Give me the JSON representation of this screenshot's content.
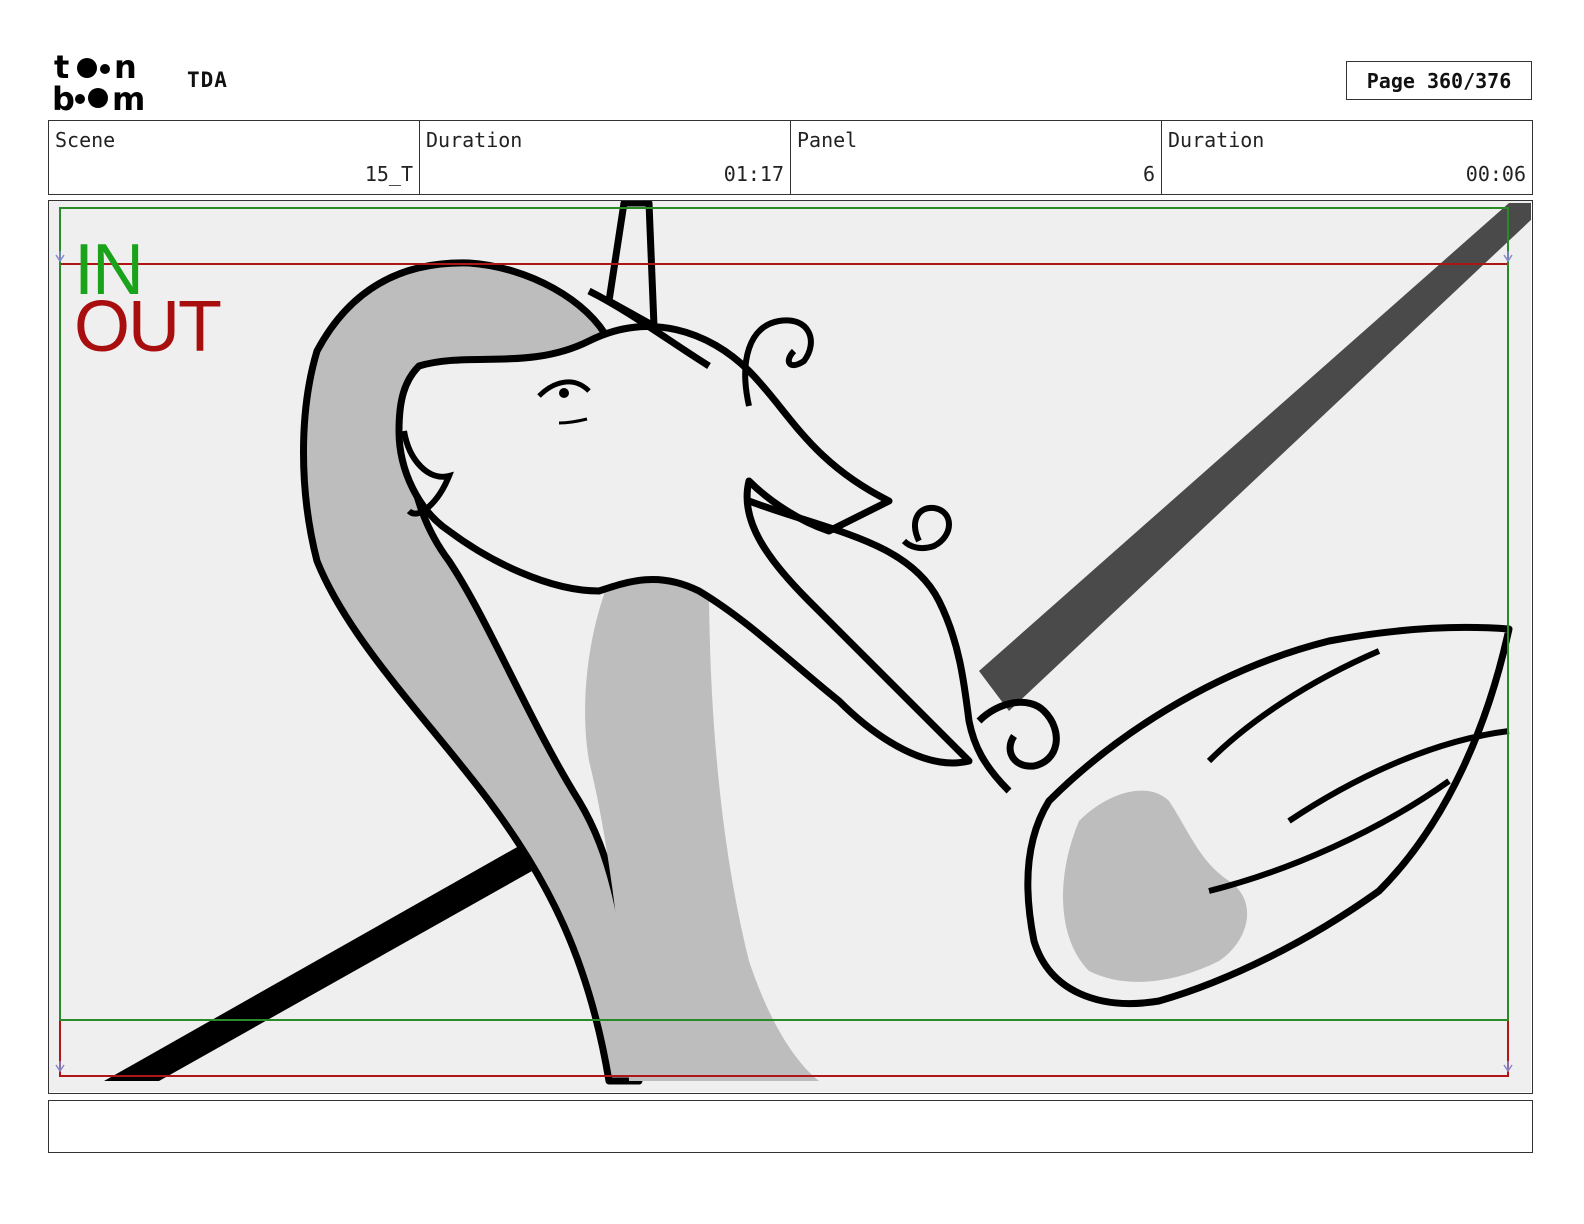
{
  "header": {
    "logo_text": "toonboom",
    "project": "TDA",
    "page": "Page 360/376"
  },
  "info": {
    "scene_label": "Scene",
    "scene_value": "15_T",
    "duration_label": "Duration",
    "duration_value": "01:17",
    "panel_label": "Panel",
    "panel_value": "6",
    "panel_duration_label": "Duration",
    "panel_duration_value": "00:06"
  },
  "panel": {
    "in_label": "IN",
    "out_label": "OUT",
    "colors": {
      "in_frame": "#2a8a2a",
      "out_frame": "#b01515",
      "background": "#efefef",
      "shade": "#bdbdbd",
      "line": "#000000"
    }
  },
  "caption": {
    "text": ""
  }
}
